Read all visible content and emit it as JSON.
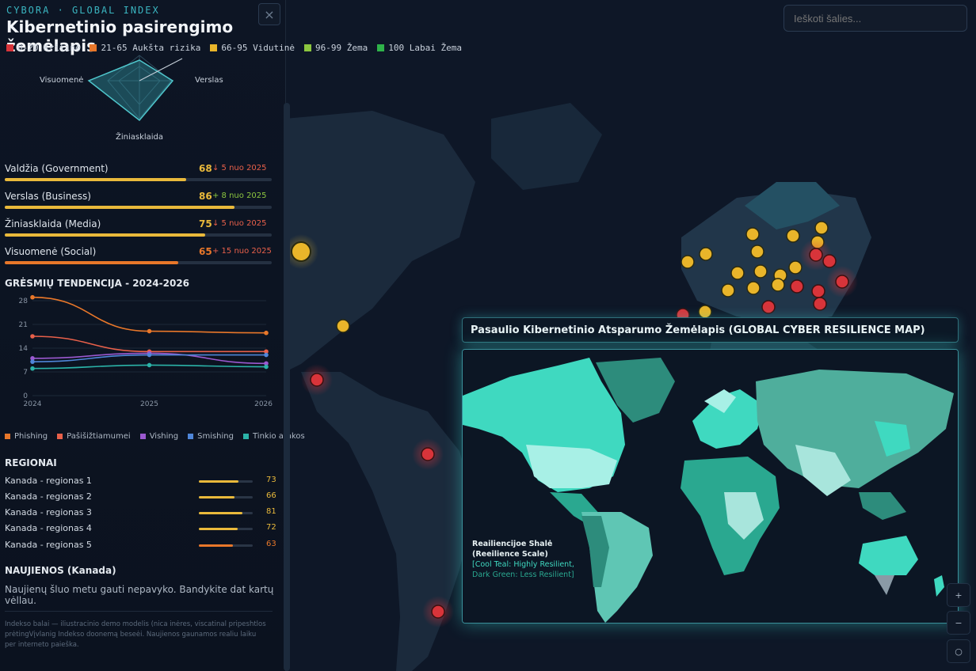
{
  "header": {
    "brand": "CYBORA · GLOBAL INDEX",
    "title": "Kibernetinio pasirengimo žemėlapis",
    "close_glyph": "×"
  },
  "legend": [
    {
      "label": "0-20 Kritinė",
      "color": "#d8343a"
    },
    {
      "label": "21-65 Aukšta rizika",
      "color": "#e8772a"
    },
    {
      "label": "66-95 Vidutinė",
      "color": "#e9b52a"
    },
    {
      "label": "96-99 Žema",
      "color": "#8cc63f"
    },
    {
      "label": "100 Labai Žema",
      "color": "#2fb34a"
    }
  ],
  "radar": {
    "labels": {
      "left": "Visuomenė",
      "right": "Verslas",
      "bottom": "Žiniasklaida"
    },
    "values": [
      68,
      86,
      75,
      65
    ]
  },
  "sectors": [
    {
      "name": "Valdžia (Government)",
      "score": "68",
      "delta": "↓ 5 nuo 2025",
      "value": 68,
      "color": "#e9b93b",
      "delta_color": "#e8604a"
    },
    {
      "name": "Verslas (Business)",
      "score": "86",
      "delta": "+ 8 nuo 2025",
      "value": 86,
      "color": "#e9b93b",
      "delta_color": "#8cc63f"
    },
    {
      "name": "Žiniasklaida (Media)",
      "score": "75",
      "delta": "↓ 5 nuo 2025",
      "value": 75,
      "color": "#e9b93b",
      "delta_color": "#e8604a"
    },
    {
      "name": "Visuomenė (Social)",
      "score": "65",
      "delta": "+ 15 nuo 2025",
      "value": 65,
      "color": "#e8772a",
      "delta_color": "#e8604a"
    }
  ],
  "trends_title": "GRĖSMIŲ TENDENCIJA - 2024-2026",
  "chart_data": {
    "type": "line",
    "x": [
      "2024",
      "2025",
      "2026"
    ],
    "y_ticks": [
      0,
      7,
      14,
      21,
      28
    ],
    "ylim": [
      0,
      28
    ],
    "series": [
      {
        "name": "Phishing",
        "values": [
          29,
          19,
          18.5
        ],
        "color": "#e8772a"
      },
      {
        "name": "Pašišižtiamumei",
        "values": [
          17.5,
          13,
          13
        ],
        "color": "#e8604a"
      },
      {
        "name": "Vishing",
        "values": [
          11,
          12.5,
          9.5
        ],
        "color": "#9b59d0"
      },
      {
        "name": "Smishing",
        "values": [
          10,
          12,
          12
        ],
        "color": "#4f86d9"
      },
      {
        "name": "Tinkio atakos",
        "values": [
          8,
          9,
          8.5
        ],
        "color": "#2bb3a8"
      }
    ]
  },
  "regions_title": "REGIONAI",
  "regions": [
    {
      "name": "Kanada - regionas 1",
      "value": 73
    },
    {
      "name": "Kanada - regionas 2",
      "value": 66
    },
    {
      "name": "Kanada - regionas 3",
      "value": 81
    },
    {
      "name": "Kanada - regionas 4",
      "value": 72
    },
    {
      "name": "Kanada - regionas 5",
      "value": 63
    }
  ],
  "news": {
    "title": "NAUJIENOS (Kanada)",
    "text": "Naujienų šluo metu gauti nepavyko. Bandykite dat kartų vėllau."
  },
  "footnote": "Indekso balai — iliustracinio demo modelis (nica inėres, viscatinal pripeshtlos prėtingVįvlanig Indekso doonemą beseėi. Naujienos gaunamos realiu laiku per interneto paieška.",
  "search": {
    "placeholder": "Ieškoti šalies..."
  },
  "overlay": {
    "title": "Pasaulio Kibernetinio Atsparumo Žemėlapis (GLOBAL CYBER RESILIENCE MAP)",
    "scale_line1": "Reailiencijoe Shalė",
    "scale_line2": "(Reeilience Scale)",
    "scale_line3": "[Cool Teal: Highly Resilient,",
    "scale_line4": "Dark Green: Less Resilient]"
  },
  "side_controls": [
    {
      "icon": "plus-icon"
    },
    {
      "icon": "minus-icon"
    },
    {
      "icon": "reset-icon",
      "glyph": "○"
    }
  ]
}
